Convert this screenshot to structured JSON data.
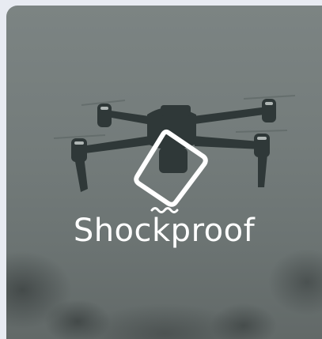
{
  "feature": {
    "label": "Shockproof",
    "icon": "shockproof-phone-icon"
  },
  "colors": {
    "card_background": "#737b7a",
    "label": "#ffffff",
    "page_background": "#e8ebf2"
  }
}
